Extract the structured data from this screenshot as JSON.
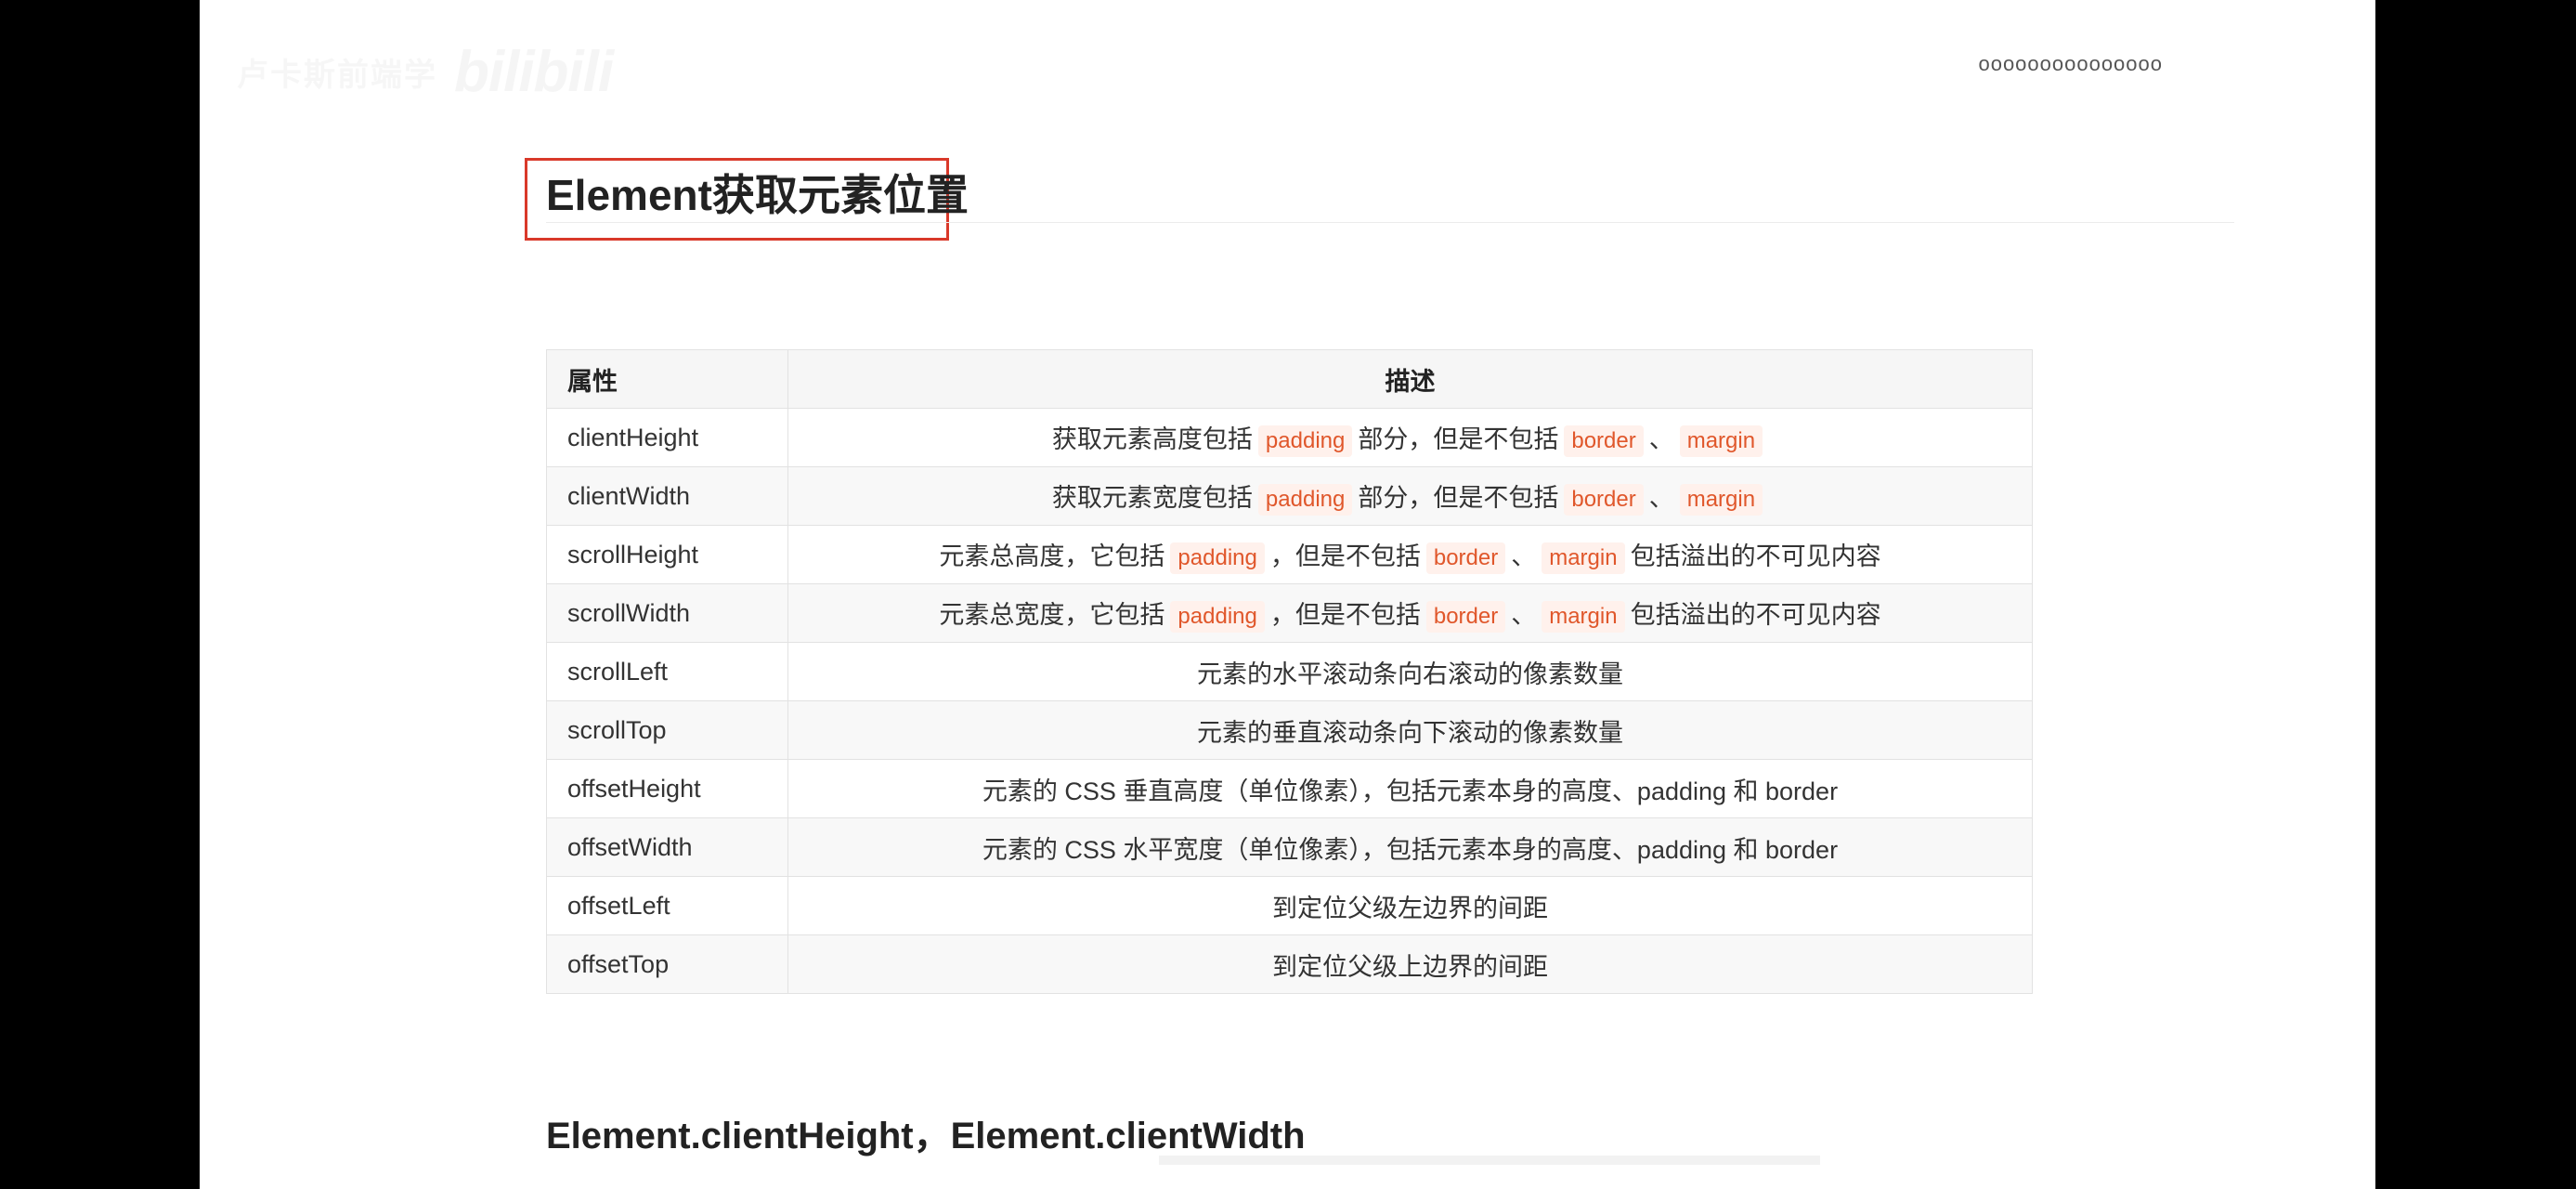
{
  "watermark": {
    "text": "卢卡斯前端学",
    "logo": "bilibili"
  },
  "top_right": "ooooooooooooooo",
  "page_title": "Element获取元素位置",
  "table": {
    "headers": [
      "属性",
      "描述"
    ],
    "rows": [
      {
        "name": "clientHeight",
        "parts": [
          {
            "t": "text",
            "v": "获取元素高度包括"
          },
          {
            "t": "code",
            "v": "padding"
          },
          {
            "t": "text",
            "v": "部分，但是不包括"
          },
          {
            "t": "code",
            "v": "border"
          },
          {
            "t": "text",
            "v": "、"
          },
          {
            "t": "code",
            "v": "margin"
          }
        ]
      },
      {
        "name": "clientWidth",
        "parts": [
          {
            "t": "text",
            "v": "获取元素宽度包括"
          },
          {
            "t": "code",
            "v": "padding"
          },
          {
            "t": "text",
            "v": "部分，但是不包括"
          },
          {
            "t": "code",
            "v": "border"
          },
          {
            "t": "text",
            "v": "、"
          },
          {
            "t": "code",
            "v": "margin"
          }
        ]
      },
      {
        "name": "scrollHeight",
        "parts": [
          {
            "t": "text",
            "v": "元素总高度，它包括"
          },
          {
            "t": "code",
            "v": "padding"
          },
          {
            "t": "text",
            "v": "，但是不包括"
          },
          {
            "t": "code",
            "v": "border"
          },
          {
            "t": "text",
            "v": "、"
          },
          {
            "t": "code",
            "v": "margin"
          },
          {
            "t": "text",
            "v": "包括溢出的不可见内容"
          }
        ]
      },
      {
        "name": "scrollWidth",
        "parts": [
          {
            "t": "text",
            "v": "元素总宽度，它包括"
          },
          {
            "t": "code",
            "v": "padding"
          },
          {
            "t": "text",
            "v": "，但是不包括"
          },
          {
            "t": "code",
            "v": "border"
          },
          {
            "t": "text",
            "v": "、"
          },
          {
            "t": "code",
            "v": "margin"
          },
          {
            "t": "text",
            "v": "包括溢出的不可见内容"
          }
        ]
      },
      {
        "name": "scrollLeft",
        "parts": [
          {
            "t": "text",
            "v": "元素的水平滚动条向右滚动的像素数量"
          }
        ]
      },
      {
        "name": "scrollTop",
        "parts": [
          {
            "t": "text",
            "v": "元素的垂直滚动条向下滚动的像素数量"
          }
        ]
      },
      {
        "name": "offsetHeight",
        "parts": [
          {
            "t": "text",
            "v": "元素的 CSS 垂直高度（单位像素），包括元素本身的高度、padding 和 border"
          }
        ]
      },
      {
        "name": "offsetWidth",
        "parts": [
          {
            "t": "text",
            "v": "元素的 CSS 水平宽度（单位像素），包括元素本身的高度、padding 和 border"
          }
        ]
      },
      {
        "name": "offsetLeft",
        "parts": [
          {
            "t": "text",
            "v": "到定位父级左边界的间距"
          }
        ]
      },
      {
        "name": "offsetTop",
        "parts": [
          {
            "t": "text",
            "v": "到定位父级上边界的间距"
          }
        ]
      }
    ]
  },
  "subtitle": "Element.clientHeight，Element.clientWidth",
  "colors": {
    "title_box_border": "#d9392a",
    "code_text": "#e0572b",
    "code_bg": "#fff1ec"
  }
}
